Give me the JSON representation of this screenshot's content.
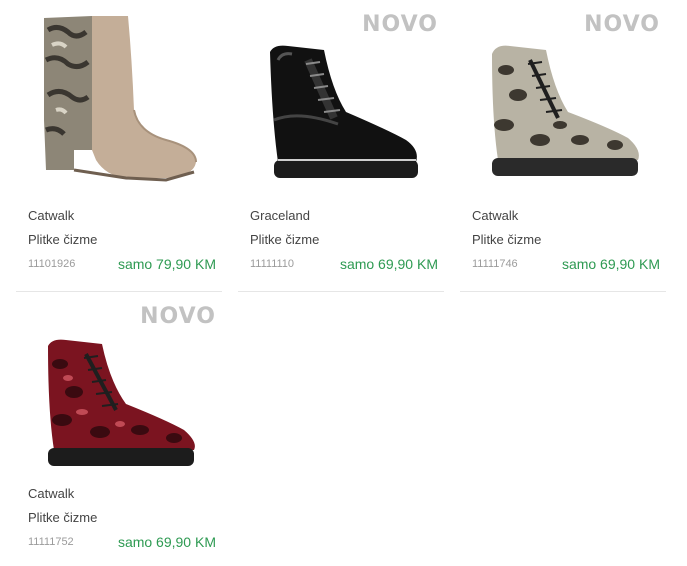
{
  "products": [
    {
      "badge": "",
      "brand": "Catwalk",
      "type": "Plitke čizme",
      "sku": "11101926",
      "price": "samo 79,90 KM",
      "image": "beige-snake-heeled-ankle-boot"
    },
    {
      "badge": "NOVO",
      "brand": "Graceland",
      "type": "Plitke čizme",
      "sku": "11111110",
      "price": "samo 69,90 KM",
      "image": "black-patent-lace-up-boot"
    },
    {
      "badge": "NOVO",
      "brand": "Catwalk",
      "type": "Plitke čizme",
      "sku": "11111746",
      "price": "samo 69,90 KM",
      "image": "snake-print-lace-up-boot"
    },
    {
      "badge": "NOVO",
      "brand": "Catwalk",
      "type": "Plitke čizme",
      "sku": "11111752",
      "price": "samo 69,90 KM",
      "image": "burgundy-snake-lace-up-boot"
    }
  ],
  "colors": {
    "price": "#2e9a52",
    "badge": "#c2c2c2",
    "sku": "#9b9b9b"
  }
}
